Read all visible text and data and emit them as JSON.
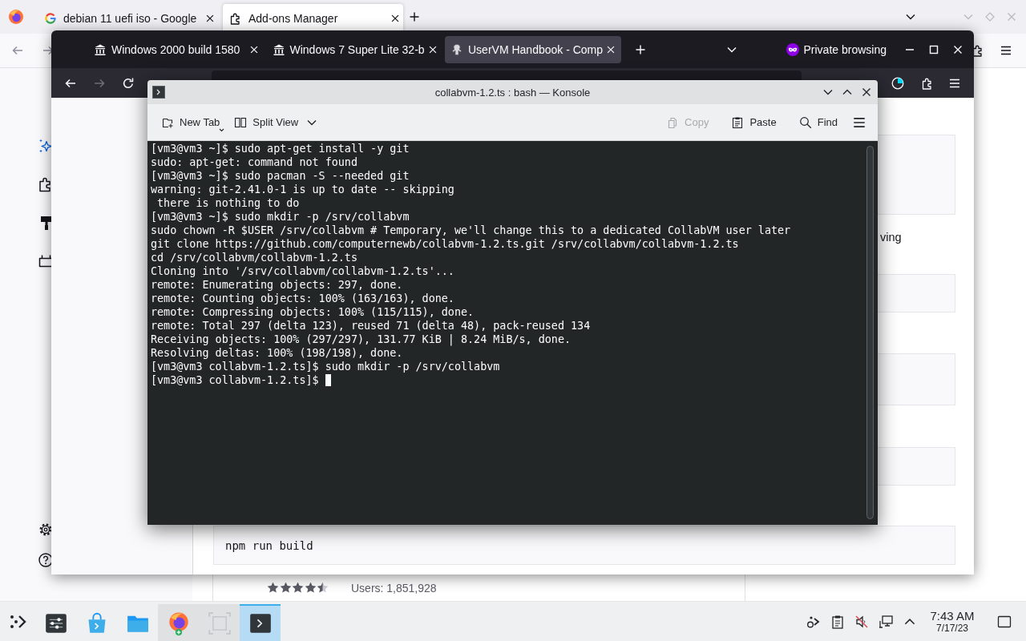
{
  "background_browser": {
    "tabs": [
      {
        "kind": "search",
        "title": "debian 11 uefi iso - Google",
        "selected": false
      },
      {
        "kind": "addons",
        "title": "Add-ons Manager",
        "selected": true
      }
    ],
    "sidebar": [
      {
        "kind": "recommendations",
        "selected": true
      },
      {
        "kind": "extensions",
        "selected": false
      },
      {
        "kind": "themes",
        "selected": false
      },
      {
        "kind": "plugins",
        "selected": false
      }
    ],
    "addon": {
      "stars": 4.5,
      "users": "Users: 1,851,928"
    }
  },
  "private_window": {
    "tabs": [
      {
        "kind": "building",
        "title": "Windows 2000 build 1580",
        "selected": false
      },
      {
        "kind": "building",
        "title": "Windows 7 Super Lite 32-b",
        "selected": false
      },
      {
        "kind": "emblem",
        "title": "UserVM Handbook - Comp",
        "selected": true
      }
    ],
    "private_label": "Private browsing",
    "nav_buttons": [
      {
        "kind": "back",
        "disabled": false
      },
      {
        "kind": "forward",
        "disabled": true
      },
      {
        "kind": "reload",
        "disabled": false
      }
    ],
    "content": [
      {
        "kind": "code"
      },
      {
        "kind": "text",
        "text": "ving"
      },
      {
        "kind": "code"
      },
      {
        "kind": "code"
      },
      {
        "kind": "code"
      },
      {
        "kind": "code",
        "text": "npm run build"
      }
    ]
  },
  "konsole": {
    "title": "collabvm-1.2.ts : bash — Konsole",
    "toolbar_left": [
      {
        "kind": "newtab",
        "label": "New Tab",
        "disabled": false
      },
      {
        "kind": "split",
        "label": "Split View",
        "disabled": false
      }
    ],
    "toolbar_right": [
      {
        "kind": "copy",
        "label": "Copy",
        "disabled": true
      },
      {
        "kind": "paste",
        "label": "Paste",
        "disabled": false
      },
      {
        "kind": "find",
        "label": "Find",
        "disabled": false
      }
    ],
    "lines": [
      "[vm3@vm3 ~]$ sudo apt-get install -y git",
      "sudo: apt-get: command not found",
      "[vm3@vm3 ~]$ sudo pacman -S --needed git",
      "warning: git-2.41.0-1 is up to date -- skipping",
      " there is nothing to do",
      "[vm3@vm3 ~]$ sudo mkdir -p /srv/collabvm",
      "sudo chown -R $USER /srv/collabvm # Temporary, we'll change this to a dedicated CollabVM user later",
      "git clone https://github.com/computernewb/collabvm-1.2.ts.git /srv/collabvm/collabvm-1.2.ts",
      "cd /srv/collabvm/collabvm-1.2.ts",
      "Cloning into '/srv/collabvm/collabvm-1.2.ts'...",
      "remote: Enumerating objects: 297, done.",
      "remote: Counting objects: 100% (163/163), done.",
      "remote: Compressing objects: 100% (115/115), done.",
      "remote: Total 297 (delta 123), reused 71 (delta 48), pack-reused 134",
      "Receiving objects: 100% (297/297), 131.77 KiB | 8.24 MiB/s, done.",
      "Resolving deltas: 100% (198/198), done.",
      "[vm3@vm3 collabvm-1.2.ts]$ sudo mkdir -p /srv/collabvm",
      "[vm3@vm3 collabvm-1.2.ts]$"
    ],
    "cursor": true
  },
  "taskbar": {
    "tasks": [
      {
        "kind": "settings",
        "running": false,
        "selected": false
      },
      {
        "kind": "store",
        "running": false,
        "selected": false
      },
      {
        "kind": "files",
        "running": false,
        "selected": false
      },
      {
        "kind": "browser",
        "running": true,
        "selected": false
      },
      {
        "kind": "screenshot",
        "running": true,
        "selected": false
      },
      {
        "kind": "terminal",
        "running": true,
        "selected": true
      }
    ],
    "clock": {
      "time": "7:43 AM",
      "date": "7/17/23"
    }
  }
}
